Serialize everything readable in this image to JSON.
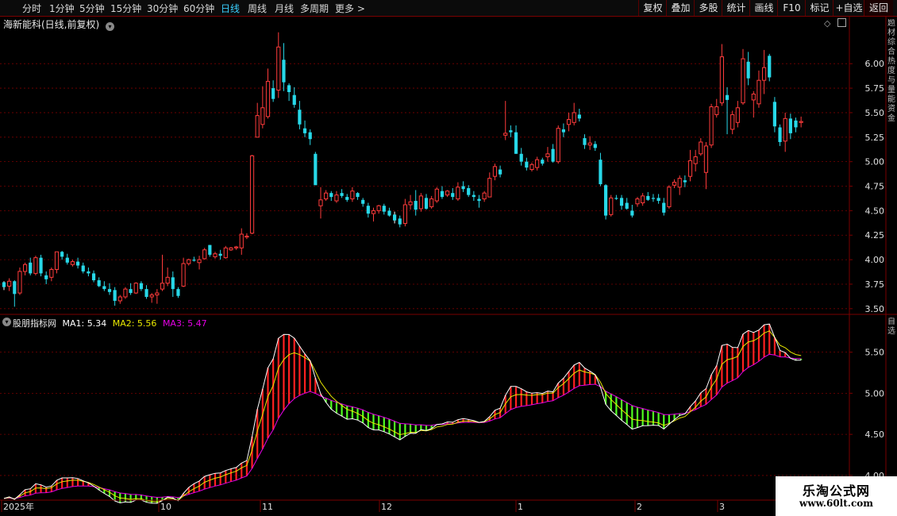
{
  "toolbar": {
    "timeframes": [
      "分时",
      "1分钟",
      "5分钟",
      "15分钟",
      "30分钟",
      "60分钟",
      "日线",
      "周线",
      "月线",
      "多周期",
      "更多 >"
    ],
    "active": "日线",
    "right_buttons": [
      "复权",
      "叠加",
      "多股",
      "统计",
      "画线",
      "F10",
      "标记",
      "+自选",
      "返回"
    ]
  },
  "main_chart": {
    "title": "海新能科(日线,前复权)",
    "y_ticks": [
      "6.00",
      "5.75",
      "5.50",
      "5.25",
      "5.00",
      "4.75",
      "4.50",
      "4.25",
      "4.00",
      "3.75",
      "3.50"
    ],
    "ylim": [
      3.45,
      6.35
    ]
  },
  "indicator": {
    "name": "股朋指标网",
    "ma1": "MA1: 5.34",
    "ma2": "MA2: 5.56",
    "ma3": "MA3: 5.47",
    "y_ticks": [
      "5.50",
      "5.00",
      "4.50",
      "4.00"
    ],
    "ylim": [
      3.7,
      5.95
    ]
  },
  "x_axis": {
    "labels": [
      "2025年",
      "10",
      "11",
      "12",
      "1",
      "2",
      "3"
    ]
  },
  "right_strip": {
    "top": "题材综合热度与量能资金",
    "mid": "自选"
  },
  "watermark": {
    "line1": "乐淘公式网",
    "line2": "www.60lt.com"
  },
  "colors": {
    "up": "#ff3b3b",
    "down": "#27d8e8",
    "ma1": "#ffffff",
    "ma2": "#e8e800",
    "ma3": "#e600e6",
    "fill_up": "#ff2020",
    "fill_down": "#50ff20",
    "grid": "#7a0000",
    "active_tf": "#3ad0ff"
  },
  "chart_data": {
    "type": "candlestick",
    "candles": [
      [
        3.77,
        3.78,
        3.69,
        3.72
      ],
      [
        3.73,
        3.81,
        3.68,
        3.78
      ],
      [
        3.78,
        3.79,
        3.52,
        3.65
      ],
      [
        3.66,
        3.92,
        3.64,
        3.88
      ],
      [
        3.88,
        3.97,
        3.84,
        3.95
      ],
      [
        3.97,
        4.02,
        3.84,
        3.86
      ],
      [
        3.86,
        4.04,
        3.84,
        4.02
      ],
      [
        4.02,
        4.05,
        3.83,
        3.86
      ],
      [
        3.84,
        3.88,
        3.75,
        3.8
      ],
      [
        3.82,
        3.92,
        3.78,
        3.9
      ],
      [
        3.9,
        4.08,
        3.86,
        4.08
      ],
      [
        4.08,
        4.09,
        4.0,
        4.03
      ],
      [
        4.02,
        4.06,
        3.95,
        3.97
      ],
      [
        3.95,
        4.0,
        3.93,
        3.98
      ],
      [
        3.98,
        4.02,
        3.91,
        3.94
      ],
      [
        3.94,
        3.97,
        3.86,
        3.88
      ],
      [
        3.88,
        3.92,
        3.83,
        3.86
      ],
      [
        3.86,
        3.89,
        3.77,
        3.79
      ],
      [
        3.79,
        3.82,
        3.72,
        3.73
      ],
      [
        3.73,
        3.78,
        3.68,
        3.7
      ],
      [
        3.7,
        3.76,
        3.64,
        3.67
      ],
      [
        3.69,
        3.72,
        3.53,
        3.58
      ],
      [
        3.58,
        3.64,
        3.55,
        3.62
      ],
      [
        3.62,
        3.72,
        3.6,
        3.7
      ],
      [
        3.7,
        3.76,
        3.64,
        3.66
      ],
      [
        3.66,
        3.77,
        3.65,
        3.76
      ],
      [
        3.76,
        3.78,
        3.68,
        3.7
      ],
      [
        3.7,
        3.74,
        3.6,
        3.62
      ],
      [
        3.62,
        3.66,
        3.56,
        3.64
      ],
      [
        3.64,
        3.7,
        3.55,
        3.66
      ],
      [
        3.7,
        4.05,
        3.68,
        3.76
      ],
      [
        3.76,
        3.92,
        3.73,
        3.82
      ],
      [
        3.82,
        3.88,
        3.62,
        3.7
      ],
      [
        3.7,
        3.72,
        3.61,
        3.63
      ],
      [
        3.73,
        4.02,
        3.72,
        3.96
      ],
      [
        3.96,
        4.01,
        3.94,
        4.0
      ],
      [
        4.0,
        4.03,
        3.98,
        3.99
      ],
      [
        3.97,
        4.04,
        3.9,
        4.0
      ],
      [
        4.01,
        4.12,
        4.0,
        4.1
      ],
      [
        4.15,
        4.15,
        4.03,
        4.05
      ],
      [
        4.03,
        4.08,
        4.01,
        4.06
      ],
      [
        4.06,
        4.1,
        4.0,
        4.04
      ],
      [
        4.02,
        4.14,
        4.01,
        4.12
      ],
      [
        4.1,
        4.13,
        4.09,
        4.12
      ],
      [
        4.12,
        4.14,
        4.1,
        4.13
      ],
      [
        4.12,
        4.32,
        4.05,
        4.26
      ],
      [
        4.23,
        4.27,
        4.21,
        4.24
      ],
      [
        4.27,
        5.07,
        4.26,
        5.06
      ],
      [
        5.25,
        5.6,
        5.25,
        5.47
      ],
      [
        5.38,
        5.77,
        5.34,
        5.55
      ],
      [
        5.46,
        5.95,
        5.44,
        5.82
      ],
      [
        5.75,
        5.83,
        5.61,
        5.64
      ],
      [
        5.73,
        6.32,
        5.65,
        6.17
      ],
      [
        6.04,
        6.21,
        5.72,
        5.81
      ],
      [
        5.78,
        5.8,
        5.62,
        5.71
      ],
      [
        5.68,
        5.76,
        5.55,
        5.58
      ],
      [
        5.53,
        5.62,
        5.33,
        5.38
      ],
      [
        5.34,
        5.42,
        5.25,
        5.29
      ],
      [
        5.3,
        5.33,
        5.17,
        5.23
      ],
      [
        5.08,
        5.1,
        4.77,
        4.76
      ],
      [
        4.55,
        4.74,
        4.42,
        4.61
      ],
      [
        4.62,
        4.71,
        4.6,
        4.68
      ],
      [
        4.68,
        4.7,
        4.6,
        4.64
      ],
      [
        4.6,
        4.7,
        4.58,
        4.66
      ],
      [
        4.68,
        4.72,
        4.63,
        4.65
      ],
      [
        4.64,
        4.67,
        4.59,
        4.61
      ],
      [
        4.62,
        4.74,
        4.59,
        4.7
      ],
      [
        4.68,
        4.69,
        4.61,
        4.64
      ],
      [
        4.61,
        4.63,
        4.54,
        4.57
      ],
      [
        4.55,
        4.58,
        4.43,
        4.47
      ],
      [
        4.47,
        4.53,
        4.39,
        4.5
      ],
      [
        4.5,
        4.56,
        4.47,
        4.55
      ],
      [
        4.55,
        4.57,
        4.46,
        4.49
      ],
      [
        4.5,
        4.53,
        4.44,
        4.45
      ],
      [
        4.46,
        4.49,
        4.37,
        4.4
      ],
      [
        4.42,
        4.45,
        4.33,
        4.36
      ],
      [
        4.37,
        4.62,
        4.34,
        4.56
      ],
      [
        4.56,
        4.66,
        4.51,
        4.59
      ],
      [
        4.6,
        4.71,
        4.45,
        4.51
      ],
      [
        4.52,
        4.68,
        4.49,
        4.65
      ],
      [
        4.63,
        4.67,
        4.51,
        4.52
      ],
      [
        4.54,
        4.65,
        4.52,
        4.62
      ],
      [
        4.6,
        4.74,
        4.58,
        4.72
      ],
      [
        4.7,
        4.75,
        4.62,
        4.64
      ],
      [
        4.66,
        4.71,
        4.64,
        4.7
      ],
      [
        4.68,
        4.73,
        4.61,
        4.64
      ],
      [
        4.62,
        4.79,
        4.6,
        4.74
      ],
      [
        4.75,
        4.8,
        4.69,
        4.72
      ],
      [
        4.73,
        4.76,
        4.64,
        4.66
      ],
      [
        4.66,
        4.7,
        4.6,
        4.64
      ],
      [
        4.62,
        4.66,
        4.53,
        4.6
      ],
      [
        4.62,
        4.7,
        4.59,
        4.68
      ],
      [
        4.64,
        4.89,
        4.64,
        4.83
      ],
      [
        4.85,
        4.98,
        4.81,
        4.95
      ],
      [
        4.92,
        4.96,
        4.84,
        4.87
      ],
      [
        5.27,
        5.62,
        5.22,
        5.29
      ],
      [
        5.32,
        5.37,
        5.25,
        5.3
      ],
      [
        5.3,
        5.37,
        5.08,
        5.08
      ],
      [
        5.08,
        5.14,
        4.96,
        5.0
      ],
      [
        5.0,
        5.04,
        4.91,
        4.94
      ],
      [
        4.92,
        4.99,
        4.9,
        4.97
      ],
      [
        4.94,
        5.05,
        4.91,
        5.02
      ],
      [
        5.02,
        5.04,
        4.96,
        4.98
      ],
      [
        5.05,
        5.15,
        5.0,
        5.08
      ],
      [
        5.13,
        5.18,
        4.99,
        5.0
      ],
      [
        5.0,
        5.37,
        4.98,
        5.34
      ],
      [
        5.33,
        5.39,
        5.25,
        5.3
      ],
      [
        5.38,
        5.5,
        5.31,
        5.43
      ],
      [
        5.4,
        5.6,
        5.37,
        5.5
      ],
      [
        5.48,
        5.54,
        5.41,
        5.44
      ],
      [
        5.24,
        5.28,
        5.13,
        5.17
      ],
      [
        5.17,
        5.26,
        5.12,
        5.19
      ],
      [
        5.18,
        5.21,
        5.11,
        5.14
      ],
      [
        5.02,
        5.09,
        4.75,
        4.77
      ],
      [
        4.76,
        4.77,
        4.41,
        4.45
      ],
      [
        4.46,
        4.66,
        4.44,
        4.63
      ],
      [
        4.63,
        4.66,
        4.61,
        4.62
      ],
      [
        4.63,
        4.66,
        4.51,
        4.55
      ],
      [
        4.58,
        4.63,
        4.51,
        4.52
      ],
      [
        4.5,
        4.56,
        4.43,
        4.45
      ],
      [
        4.57,
        4.64,
        4.54,
        4.62
      ],
      [
        4.58,
        4.68,
        4.55,
        4.65
      ],
      [
        4.65,
        4.69,
        4.6,
        4.61
      ],
      [
        4.63,
        4.67,
        4.59,
        4.62
      ],
      [
        4.63,
        4.67,
        4.57,
        4.6
      ],
      [
        4.58,
        4.63,
        4.45,
        4.48
      ],
      [
        4.54,
        4.76,
        4.52,
        4.74
      ],
      [
        4.76,
        4.82,
        4.73,
        4.79
      ],
      [
        4.74,
        4.86,
        4.66,
        4.83
      ],
      [
        4.81,
        4.86,
        4.74,
        4.79
      ],
      [
        4.85,
        5.12,
        4.8,
        5.01
      ],
      [
        4.98,
        5.12,
        4.9,
        5.05
      ],
      [
        5.08,
        5.24,
        5.06,
        5.2
      ],
      [
        4.89,
        5.2,
        4.72,
        5.16
      ],
      [
        5.17,
        5.59,
        5.14,
        5.56
      ],
      [
        5.48,
        5.64,
        5.45,
        5.56
      ],
      [
        5.6,
        6.2,
        5.57,
        6.07
      ],
      [
        5.68,
        5.76,
        5.28,
        5.63
      ],
      [
        5.33,
        5.52,
        5.28,
        5.48
      ],
      [
        5.4,
        5.62,
        5.35,
        5.55
      ],
      [
        5.6,
        6.15,
        5.58,
        6.05
      ],
      [
        6.02,
        6.12,
        5.78,
        5.85
      ],
      [
        5.63,
        5.72,
        5.45,
        5.69
      ],
      [
        5.59,
        5.93,
        5.55,
        5.83
      ],
      [
        5.83,
        6.14,
        5.69,
        5.96
      ],
      [
        6.08,
        6.1,
        5.82,
        5.86
      ],
      [
        5.61,
        5.66,
        5.3,
        5.36
      ],
      [
        5.35,
        5.38,
        5.16,
        5.2
      ],
      [
        5.21,
        5.5,
        5.1,
        5.44
      ],
      [
        5.44,
        5.49,
        5.23,
        5.29
      ],
      [
        5.42,
        5.45,
        5.3,
        5.35
      ],
      [
        5.4,
        5.46,
        5.35,
        5.41
      ]
    ],
    "indicator_series": [
      "MA1",
      "MA2",
      "MA3"
    ]
  }
}
